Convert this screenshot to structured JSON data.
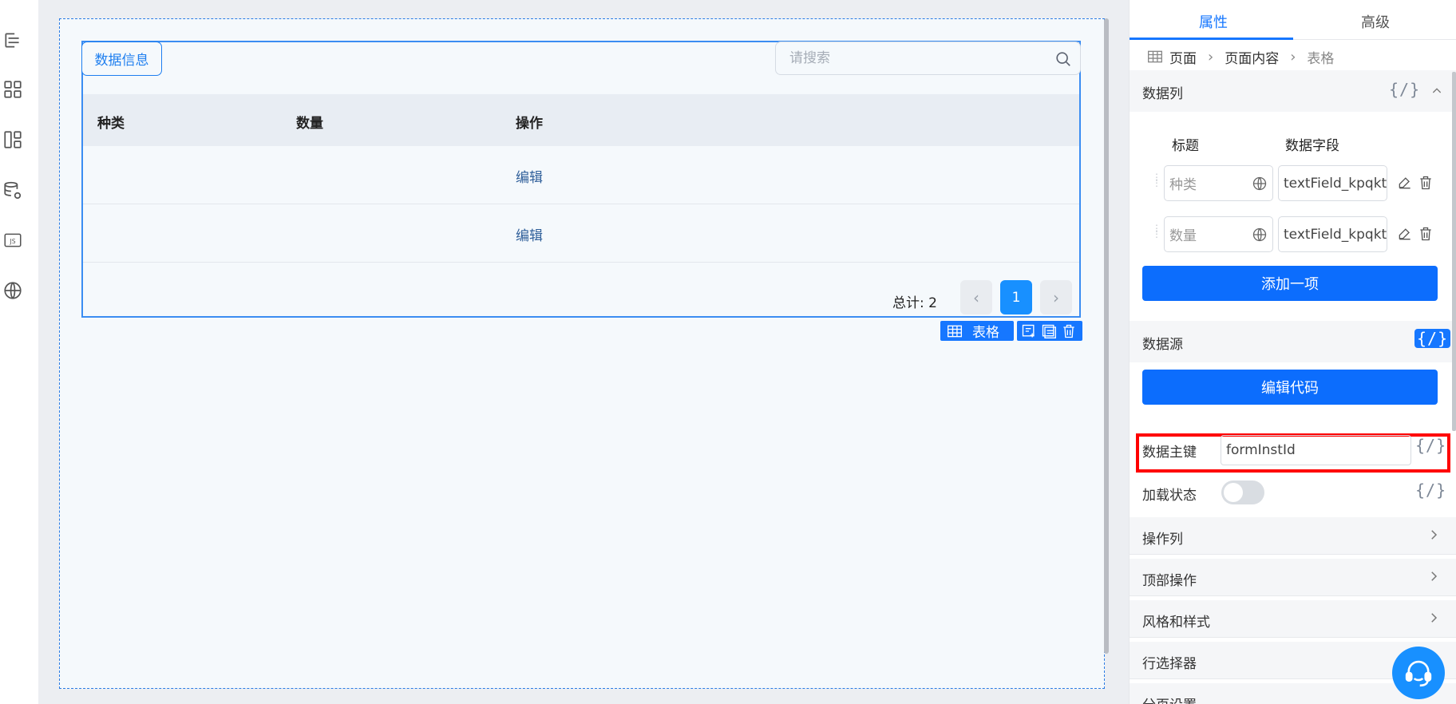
{
  "canvas": {
    "data_info_button": "数据信息",
    "search": {
      "placeholder": "请搜索"
    },
    "table": {
      "columns": [
        "种类",
        "数量",
        "操作"
      ],
      "rows": [
        {
          "category": "",
          "quantity": "",
          "action": "编辑"
        },
        {
          "category": "",
          "quantity": "",
          "action": "编辑"
        }
      ]
    },
    "pagination": {
      "total": "总计: 2",
      "current_page": "1",
      "prev": "‹",
      "next": "›"
    },
    "selection_toolbar": {
      "label": "表格"
    }
  },
  "right_panel": {
    "tabs": [
      "属性",
      "高级"
    ],
    "active_tab": "属性",
    "breadcrumb": [
      "页面",
      "页面内容",
      "表格"
    ],
    "data_columns": {
      "title": "数据列",
      "code_tag": "{/}",
      "header_title": "标题",
      "header_field": "数据字段",
      "items": [
        {
          "title_placeholder": "种类",
          "field": "textField_kpqkt("
        },
        {
          "title_placeholder": "数量",
          "field": "textField_kpqkt("
        }
      ],
      "add_button": "添加一项"
    },
    "data_source": {
      "title": "数据源",
      "code_tag": "{/}",
      "edit_code_button": "编辑代码"
    },
    "primary_key": {
      "label": "数据主键",
      "value": "formInstId",
      "code_tag": "{/}"
    },
    "loading_state": {
      "label": "加载状态",
      "enabled": false,
      "code_tag": "{/}"
    },
    "sections": [
      "操作列",
      "顶部操作",
      "风格和样式",
      "行选择器",
      "分页设置"
    ]
  },
  "colors": {
    "primary": "#1677ff",
    "highlight": "#ff0000",
    "canvas_bg": "#eceef2"
  }
}
